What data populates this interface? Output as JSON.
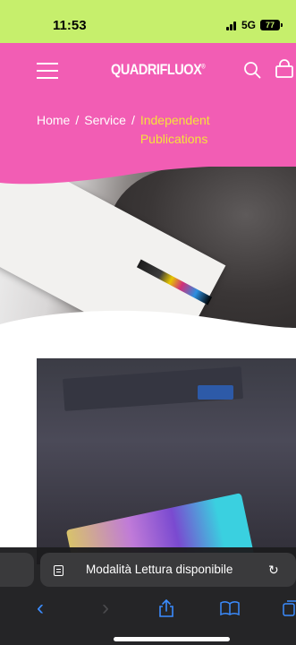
{
  "status_bar": {
    "time": "11:53",
    "network": "5G",
    "battery": "77",
    "color": "#c6ef6c"
  },
  "header": {
    "brand": "QUADRIFLUOX",
    "brand_mark": "®",
    "color": "#f25db4",
    "icons": [
      "menu-icon",
      "search-icon",
      "shopping-bag-icon"
    ]
  },
  "breadcrumb": {
    "home": "Home",
    "separator": "/",
    "service": "Service",
    "current": "Independent Publications",
    "current_color": "#f6e23a"
  },
  "safari": {
    "reader_text": "Modalità Lettura disponibile",
    "reload_symbol": "↻",
    "toolbar": [
      {
        "name": "back-icon",
        "glyph": "‹"
      },
      {
        "name": "forward-icon",
        "glyph": "›"
      },
      {
        "name": "share-icon",
        "glyph": "⇧"
      },
      {
        "name": "bookmarks-icon",
        "glyph": "▭"
      },
      {
        "name": "tabs-icon",
        "glyph": "❐"
      }
    ]
  }
}
